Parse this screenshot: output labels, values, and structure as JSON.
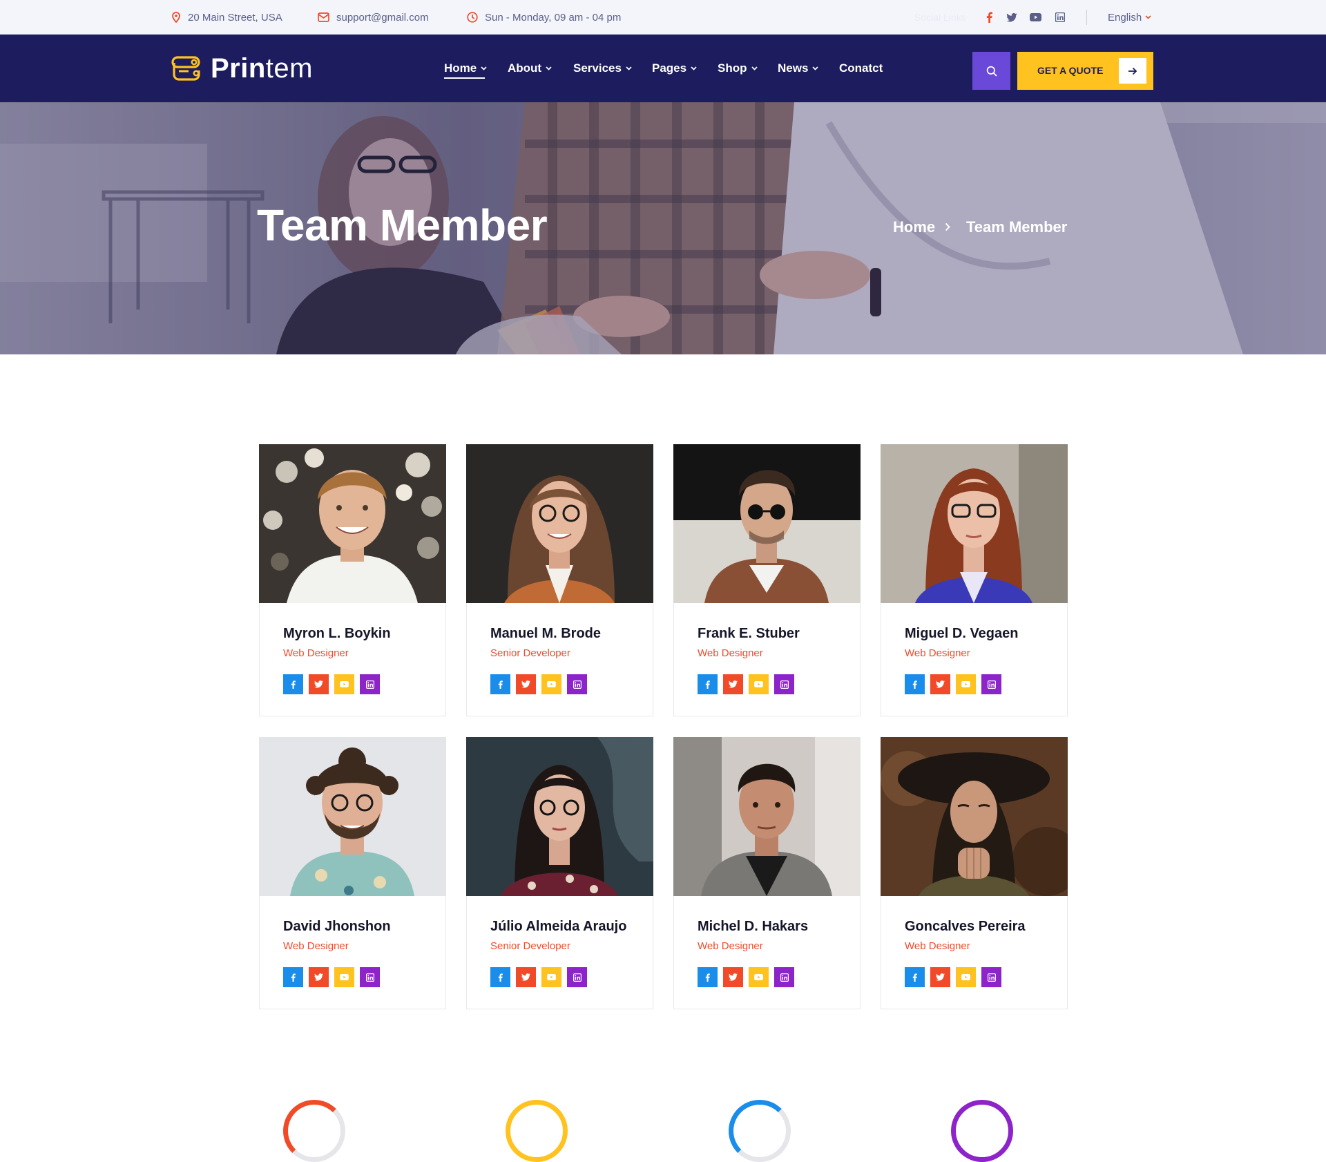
{
  "topbar": {
    "address": "20 Main Street, USA",
    "email": "support@gmail.com",
    "hours": "Sun - Monday, 09 am - 04 pm",
    "social_label": "Social Links",
    "language": "English"
  },
  "brand": {
    "name_bold": "Prin",
    "name_light": "tem",
    "accent": "#ffc21e",
    "navy": "#1c1c5e",
    "orange": "#f14a29",
    "purple": "#6b49d8"
  },
  "nav": {
    "items": [
      {
        "label": "Home",
        "dropdown": true,
        "active": true
      },
      {
        "label": "About",
        "dropdown": true
      },
      {
        "label": "Services",
        "dropdown": true
      },
      {
        "label": "Pages",
        "dropdown": true
      },
      {
        "label": "Shop",
        "dropdown": true
      },
      {
        "label": "News",
        "dropdown": true
      },
      {
        "label": "Conatct",
        "dropdown": false
      }
    ],
    "quote_label": "GET A QUOTE"
  },
  "hero": {
    "title": "Team Member",
    "breadcrumb_home": "Home",
    "breadcrumb_current": "Team Member"
  },
  "team": [
    {
      "name": "Myron L. Boykin",
      "role": "Web Designer"
    },
    {
      "name": "Manuel M. Brode",
      "role": "Senior Developer"
    },
    {
      "name": "Frank E. Stuber",
      "role": "Web Designer"
    },
    {
      "name": "Miguel D. Vegaen",
      "role": "Web Designer"
    },
    {
      "name": "David Jhonshon",
      "role": "Web Designer"
    },
    {
      "name": "Júlio Almeida Araujo",
      "role": "Senior Developer"
    },
    {
      "name": "Michel D. Hakars",
      "role": "Web Designer"
    },
    {
      "name": "Goncalves Pereira",
      "role": "Web Designer"
    }
  ],
  "social_icons": [
    "facebook-icon",
    "twitter-icon",
    "youtube-icon",
    "linkedin-icon"
  ]
}
